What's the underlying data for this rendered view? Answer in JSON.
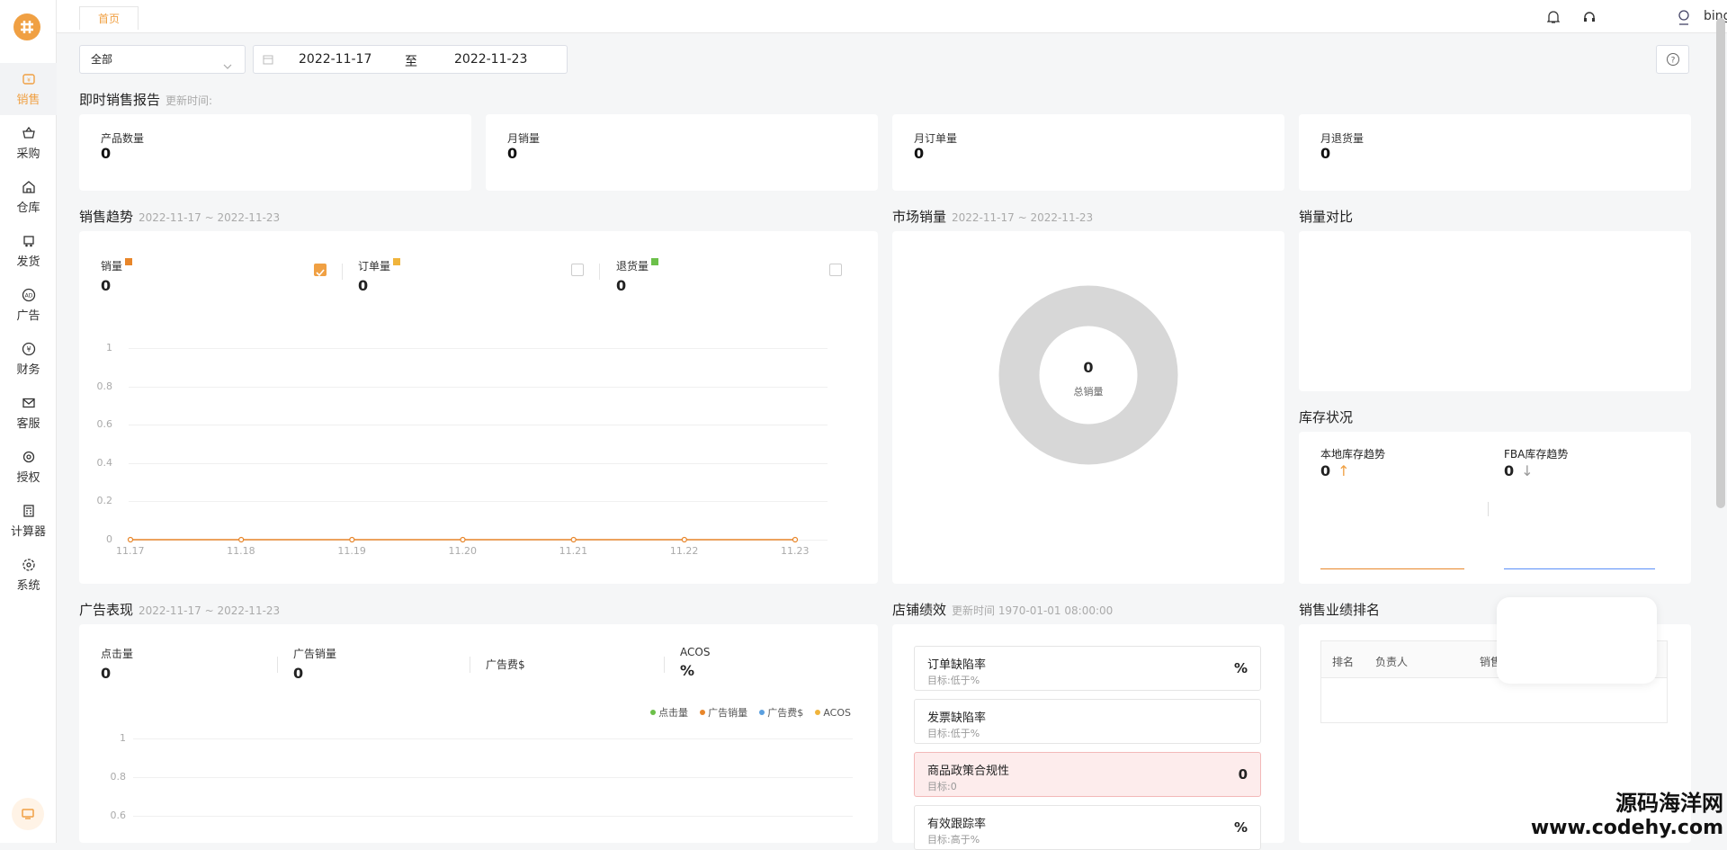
{
  "sidebar": {
    "items": [
      {
        "label": "销售",
        "icon": "sales-icon"
      },
      {
        "label": "采购",
        "icon": "basket-icon"
      },
      {
        "label": "仓库",
        "icon": "warehouse-icon"
      },
      {
        "label": "发货",
        "icon": "truck-icon"
      },
      {
        "label": "广告",
        "icon": "ad-icon"
      },
      {
        "label": "财务",
        "icon": "yen-icon"
      },
      {
        "label": "客服",
        "icon": "mail-icon"
      },
      {
        "label": "授权",
        "icon": "gear-icon"
      },
      {
        "label": "计算器",
        "icon": "calculator-icon"
      },
      {
        "label": "系统",
        "icon": "settings-icon"
      }
    ],
    "accent": "#f0a043"
  },
  "topbar": {
    "tab": "首页",
    "user": "bingo"
  },
  "filter": {
    "select": "全部",
    "date_start": "2022-11-17",
    "date_to": "至",
    "date_end": "2022-11-23"
  },
  "instant": {
    "title": "即时销售报告",
    "update_label": "更新时间:",
    "kpis": [
      {
        "label": "产品数量",
        "value": "0"
      },
      {
        "label": "月销量",
        "value": "0"
      },
      {
        "label": "月订单量",
        "value": "0"
      },
      {
        "label": "月退货量",
        "value": "0"
      }
    ]
  },
  "trend": {
    "title": "销售趋势",
    "range": "2022-11-17 ~ 2022-11-23",
    "metrics": [
      {
        "label": "销量",
        "value": "0",
        "color": "#e8862a",
        "checked": true
      },
      {
        "label": "订单量",
        "value": "0",
        "color": "#f0b43c",
        "checked": false
      },
      {
        "label": "退货量",
        "value": "0",
        "color": "#6cc04a",
        "checked": false
      }
    ],
    "yticks": [
      "1",
      "0.8",
      "0.6",
      "0.4",
      "0.2",
      "0"
    ],
    "xticks": [
      "11.17",
      "11.18",
      "11.19",
      "11.20",
      "11.21",
      "11.22",
      "11.23"
    ]
  },
  "market": {
    "title": "市场销量",
    "range": "2022-11-17 ~ 2022-11-23",
    "total": "0",
    "total_label": "总销量",
    "ring_color": "#d7d7d7"
  },
  "compare": {
    "title": "销量对比"
  },
  "inventory": {
    "title": "库存状况",
    "local_label": "本地库存趋势",
    "local_value": "0",
    "fba_label": "FBA库存趋势",
    "fba_value": "0",
    "up_color": "#f0a043",
    "down_color": "#999999",
    "local_line": "#e8862a",
    "fba_line": "#5b8ff9"
  },
  "ads": {
    "title": "广告表现",
    "range": "2022-11-17 ~ 2022-11-23",
    "metrics": [
      {
        "label": "点击量",
        "value": "0"
      },
      {
        "label": "广告销量",
        "value": "0"
      },
      {
        "label": "广告费$",
        "value": ""
      },
      {
        "label": "ACOS",
        "value": "%"
      }
    ],
    "legend": [
      {
        "label": "点击量",
        "color": "#6cc04a"
      },
      {
        "label": "广告销量",
        "color": "#e8862a"
      },
      {
        "label": "广告费$",
        "color": "#5ba0e0"
      },
      {
        "label": "ACOS",
        "color": "#f0b43c"
      }
    ],
    "yticks": [
      "1",
      "0.8",
      "0.6"
    ]
  },
  "shop": {
    "title": "店铺绩效",
    "update": "更新时间 1970-01-01 08:00:00",
    "items": [
      {
        "title": "订单缺陷率",
        "sub": "目标:低于%",
        "value": "%"
      },
      {
        "title": "发票缺陷率",
        "sub": "目标:低于%",
        "value": ""
      },
      {
        "title": "商品政策合规性",
        "sub": "目标:0",
        "value": "0",
        "warn": true
      },
      {
        "title": "有效跟踪率",
        "sub": "目标:高于%",
        "value": "%"
      }
    ]
  },
  "ranking": {
    "title": "销售业绩排名",
    "cols": [
      "排名",
      "负责人",
      "销售"
    ]
  },
  "chart_data": {
    "type": "line",
    "title": "",
    "categories": [
      "11.17",
      "11.18",
      "11.19",
      "11.20",
      "11.21",
      "11.22",
      "11.23"
    ],
    "series": [
      {
        "name": "销量",
        "values": [
          0,
          0,
          0,
          0,
          0,
          0,
          0
        ]
      }
    ],
    "ylim": [
      0,
      1
    ],
    "grid": true
  },
  "watermark": {
    "line1": "源码海洋网",
    "line2": "www.codehy.com"
  }
}
